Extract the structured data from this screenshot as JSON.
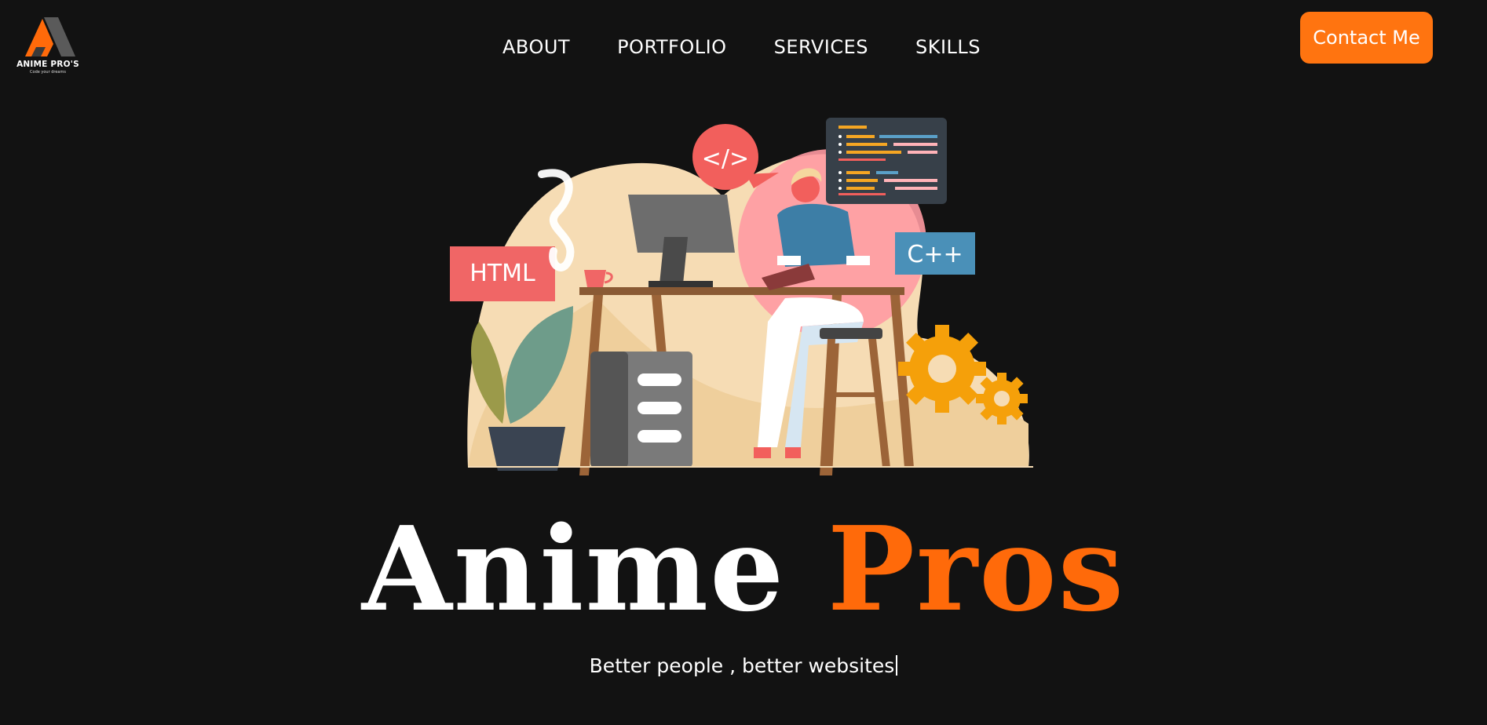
{
  "header": {
    "logo_text": "ANIME PRO'S",
    "logo_tagline": "Code your dreams",
    "nav": [
      {
        "label": "ABOUT"
      },
      {
        "label": "PORTFOLIO"
      },
      {
        "label": "SERVICES"
      },
      {
        "label": "SKILLS"
      }
    ],
    "contact_label": "Contact Me"
  },
  "illustration": {
    "code_bubble": "</>",
    "html_label": "HTML",
    "cpp_label": "C++"
  },
  "hero": {
    "title_word1": "Anime",
    "title_word2": "Pros",
    "tagline": "Better people , better websites"
  },
  "colors": {
    "background": "#121212",
    "accent": "#ff7410",
    "title_accent": "#ff6a0a",
    "text": "#ffffff"
  }
}
